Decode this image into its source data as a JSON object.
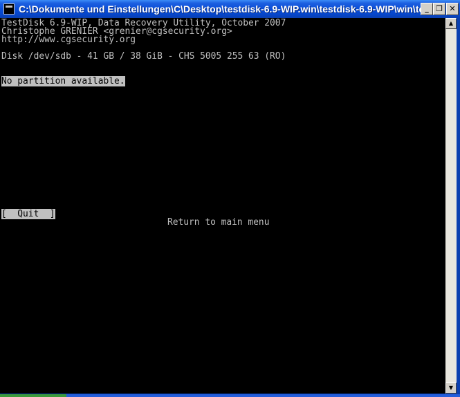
{
  "window": {
    "title": "C:\\Dokumente und Einstellungen\\C\\Desktop\\testdisk-6.9-WIP.win\\testdisk-6.9-WIP\\win\\test...",
    "minimize_glyph": "_",
    "maximize_glyph": "❐",
    "close_glyph": "✕",
    "icon": "console-icon"
  },
  "console": {
    "header_lines": [
      "TestDisk 6.9-WIP, Data Recovery Utility, October 2007",
      "Christophe GRENIER <grenier@cgsecurity.org>",
      "http://www.cgsecurity.org"
    ],
    "disk_info": "Disk /dev/sdb - 41 GB / 38 GiB - CHS 5005 255 63 (RO)",
    "message": "No partition available.",
    "quit_button": "[  Quit  ]",
    "hint": "Return to main menu"
  },
  "scrollbar": {
    "up_glyph": "▲",
    "down_glyph": "▼"
  },
  "colors": {
    "console_bg": "#000000",
    "console_text": "#c0c0c0",
    "titlebar": "#0a4ed8"
  }
}
